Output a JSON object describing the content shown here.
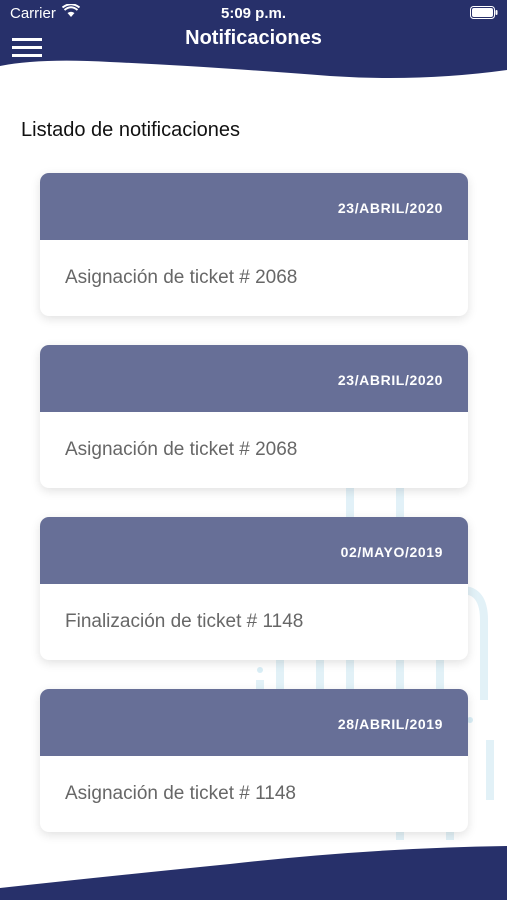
{
  "status_bar": {
    "carrier": "Carrier",
    "time": "5:09 p.m."
  },
  "nav": {
    "title": "Notificaciones",
    "menu_icon": "hamburger-menu-icon"
  },
  "section_title": "Listado de notificaciones",
  "colors": {
    "header": "#27306a",
    "card_header": "#676f97",
    "card_text": "#676767"
  },
  "notifications": [
    {
      "date": "23/ABRIL/2020",
      "text": "Asignación de ticket # 2068"
    },
    {
      "date": "23/ABRIL/2020",
      "text": "Asignación de ticket # 2068"
    },
    {
      "date": "02/MAYO/2019",
      "text": "Finalización de ticket # 1148"
    },
    {
      "date": "28/ABRIL/2019",
      "text": "Asignación de ticket # 1148"
    }
  ]
}
